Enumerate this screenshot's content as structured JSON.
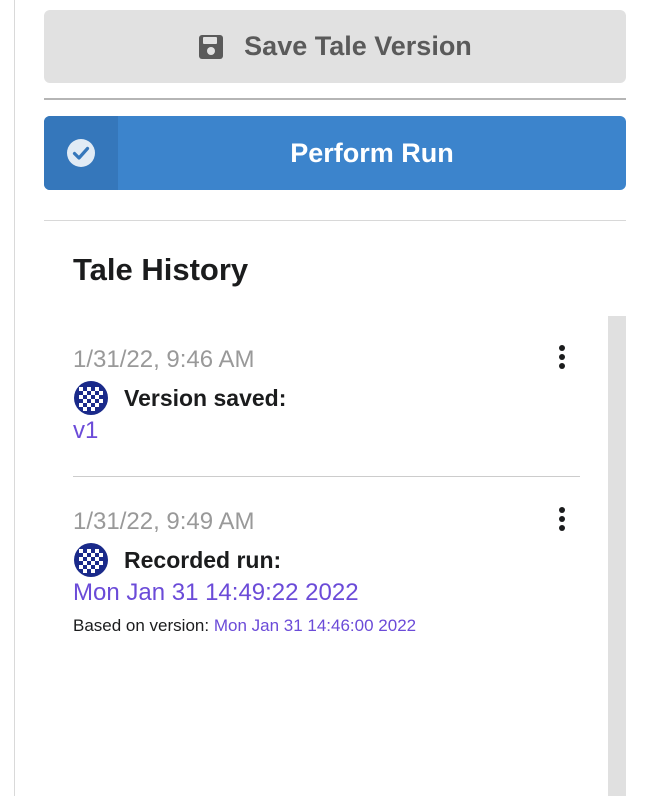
{
  "save_button": {
    "label": "Save Tale Version",
    "icon": "floppy-disk-icon"
  },
  "run_button": {
    "label": "Perform Run",
    "icon": "check-circle-icon",
    "color": "#3c84cc"
  },
  "history": {
    "title": "Tale History",
    "entries": [
      {
        "timestamp": "1/31/22, 9:46 AM",
        "action": "Version saved:",
        "link": "v1"
      },
      {
        "timestamp": "1/31/22, 9:49 AM",
        "action": "Recorded run:",
        "link": "Mon Jan 31 14:49:22 2022",
        "based_on_label": "Based on version:",
        "based_on_link": "Mon Jan 31 14:46:00 2022"
      }
    ]
  },
  "colors": {
    "link": "#6b4bd8",
    "timestamp": "#999999",
    "save_button_bg": "#e1e1e1"
  }
}
